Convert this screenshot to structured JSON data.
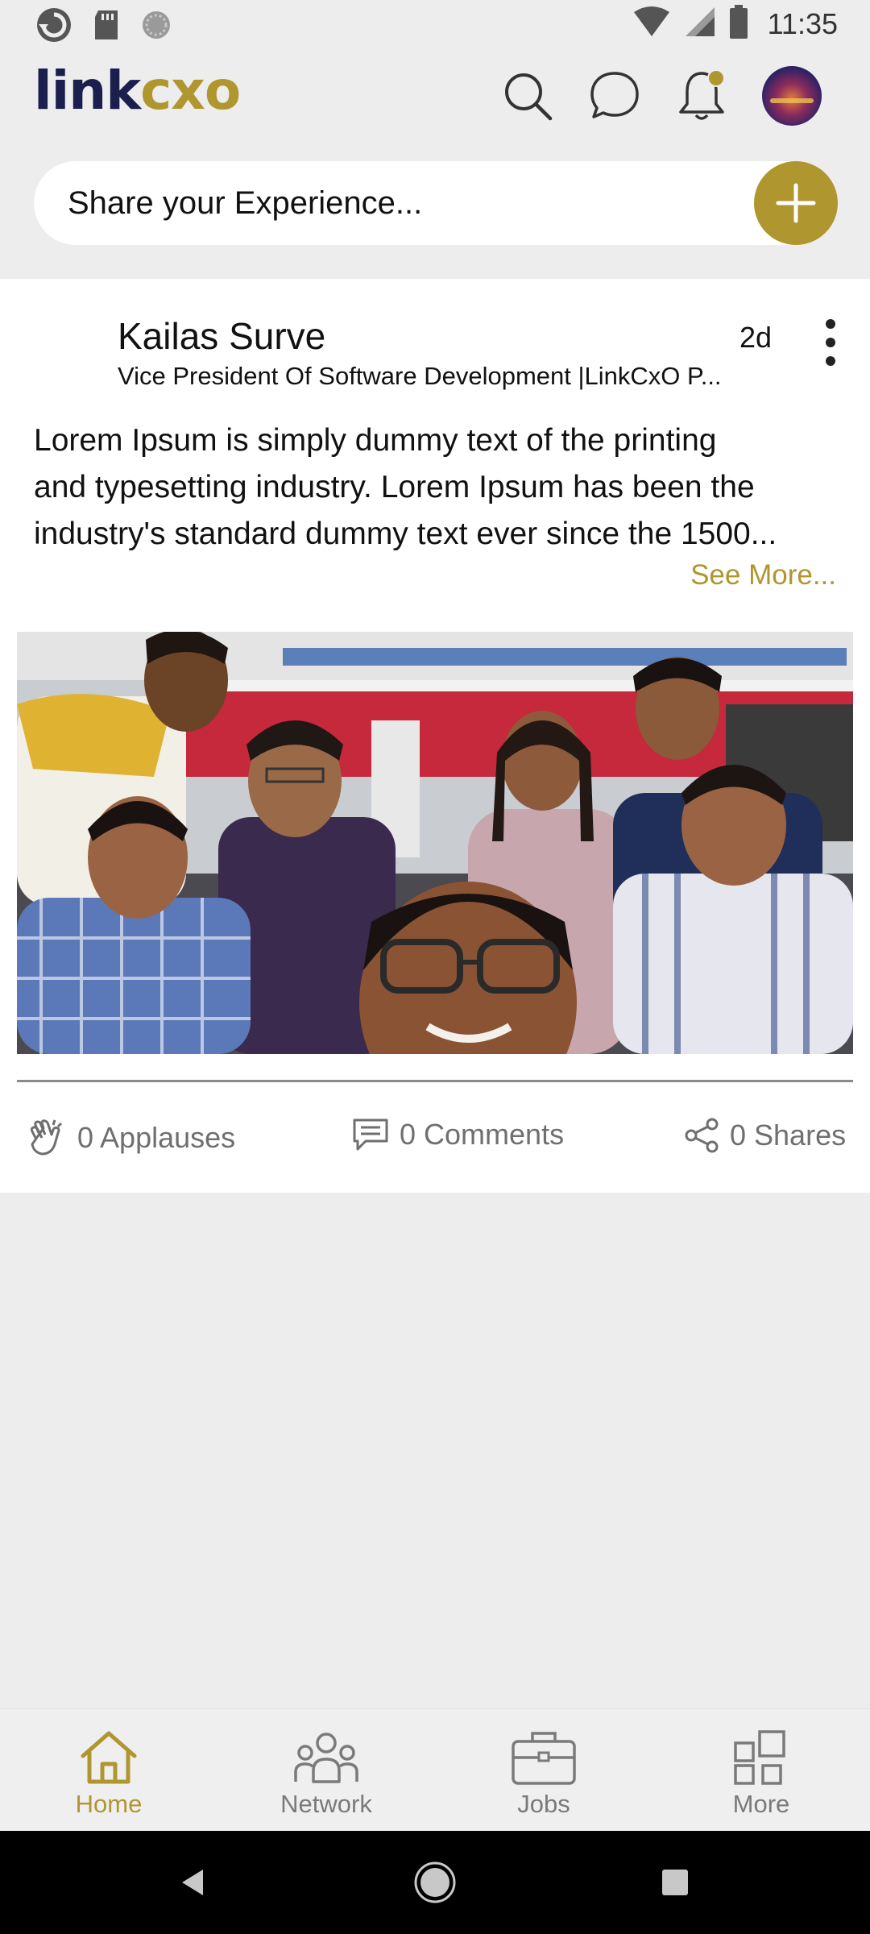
{
  "status_bar": {
    "time": "11:35",
    "icons": [
      "sync-icon",
      "sd-card-icon",
      "loading-icon",
      "wifi-icon",
      "signal-icon",
      "battery-icon"
    ]
  },
  "app_bar": {
    "logo_link": "link",
    "logo_cxo": "cxo",
    "icons": [
      "search-icon",
      "chat-icon",
      "notification-bell-icon",
      "profile-avatar"
    ]
  },
  "share": {
    "placeholder": "Share your Experience..."
  },
  "post": {
    "author_name": "Kailas Surve",
    "author_title": "Vice President Of Software Development |LinkCxO P...",
    "time_ago": "2d",
    "body_lines": [
      "Lorem Ipsum is simply dummy text of the printing",
      "and typesetting industry. Lorem Ipsum has been the",
      "industry's standard dummy text ever since the 1500..."
    ],
    "see_more": "See More...",
    "applauses": "0 Applauses",
    "comments": "0 Comments",
    "shares": "0 Shares"
  },
  "bottom_nav": {
    "items": [
      {
        "label": "Home",
        "icon": "home-icon",
        "active": true
      },
      {
        "label": "Network",
        "icon": "network-icon",
        "active": false
      },
      {
        "label": "Jobs",
        "icon": "briefcase-icon",
        "active": false
      },
      {
        "label": "More",
        "icon": "grid-icon",
        "active": false
      }
    ]
  },
  "system_nav": [
    "back-button",
    "home-button",
    "recents-button"
  ],
  "colors": {
    "brand_gold": "#b0962f",
    "brand_navy": "#1a1f4e",
    "background": "#ededed",
    "card": "#ffffff"
  }
}
